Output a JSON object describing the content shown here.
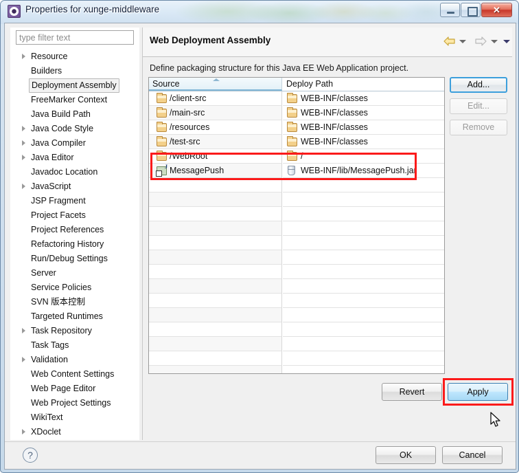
{
  "window": {
    "title": "Properties for xunge-middleware",
    "icon": "eclipse-properties-icon",
    "controls": {
      "minimize": "minimize-button",
      "maximize": "maximize-button",
      "close_glyph": "✕"
    }
  },
  "sidebar": {
    "filter": {
      "placeholder": "type filter text",
      "value": ""
    },
    "items": [
      {
        "label": "Resource",
        "expandable": true,
        "selected": false
      },
      {
        "label": "Builders",
        "expandable": false,
        "selected": false
      },
      {
        "label": "Deployment Assembly",
        "expandable": false,
        "selected": true
      },
      {
        "label": "FreeMarker Context",
        "expandable": false,
        "selected": false
      },
      {
        "label": "Java Build Path",
        "expandable": false,
        "selected": false
      },
      {
        "label": "Java Code Style",
        "expandable": true,
        "selected": false
      },
      {
        "label": "Java Compiler",
        "expandable": true,
        "selected": false
      },
      {
        "label": "Java Editor",
        "expandable": true,
        "selected": false
      },
      {
        "label": "Javadoc Location",
        "expandable": false,
        "selected": false
      },
      {
        "label": "JavaScript",
        "expandable": true,
        "selected": false
      },
      {
        "label": "JSP Fragment",
        "expandable": false,
        "selected": false
      },
      {
        "label": "Project Facets",
        "expandable": false,
        "selected": false
      },
      {
        "label": "Project References",
        "expandable": false,
        "selected": false
      },
      {
        "label": "Refactoring History",
        "expandable": false,
        "selected": false
      },
      {
        "label": "Run/Debug Settings",
        "expandable": false,
        "selected": false
      },
      {
        "label": "Server",
        "expandable": false,
        "selected": false
      },
      {
        "label": "Service Policies",
        "expandable": false,
        "selected": false
      },
      {
        "label": "SVN 版本控制",
        "expandable": false,
        "selected": false
      },
      {
        "label": "Targeted Runtimes",
        "expandable": false,
        "selected": false
      },
      {
        "label": "Task Repository",
        "expandable": true,
        "selected": false
      },
      {
        "label": "Task Tags",
        "expandable": false,
        "selected": false
      },
      {
        "label": "Validation",
        "expandable": true,
        "selected": false
      },
      {
        "label": "Web Content Settings",
        "expandable": false,
        "selected": false
      },
      {
        "label": "Web Page Editor",
        "expandable": false,
        "selected": false
      },
      {
        "label": "Web Project Settings",
        "expandable": false,
        "selected": false
      },
      {
        "label": "WikiText",
        "expandable": false,
        "selected": false
      },
      {
        "label": "XDoclet",
        "expandable": true,
        "selected": false
      }
    ]
  },
  "page": {
    "title": "Web Deployment Assembly",
    "description": "Define packaging structure for this Java EE Web Application project.",
    "nav": {
      "back_icon": "back-arrow-icon",
      "back_dropdown_icon": "chevron-down-icon",
      "forward_icon": "forward-arrow-icon",
      "forward_dropdown_icon": "chevron-down-icon",
      "menu_icon": "chevron-down-icon"
    }
  },
  "table": {
    "columns": [
      {
        "key": "source",
        "label": "Source",
        "sorted": "asc"
      },
      {
        "key": "deploy",
        "label": "Deploy Path",
        "sorted": ""
      }
    ],
    "rows": [
      {
        "source": "/client-src",
        "source_icon": "folder-icon",
        "deploy": "WEB-INF/classes",
        "deploy_icon": "folder-icon"
      },
      {
        "source": "/main-src",
        "source_icon": "folder-icon",
        "deploy": "WEB-INF/classes",
        "deploy_icon": "folder-icon"
      },
      {
        "source": "/resources",
        "source_icon": "folder-icon",
        "deploy": "WEB-INF/classes",
        "deploy_icon": "folder-icon"
      },
      {
        "source": "/test-src",
        "source_icon": "folder-icon",
        "deploy": "WEB-INF/classes",
        "deploy_icon": "folder-icon"
      },
      {
        "source": "/WebRoot",
        "source_icon": "folder-icon",
        "deploy": "/",
        "deploy_icon": "folder-icon"
      },
      {
        "source": "MessagePush",
        "source_icon": "java-project-icon",
        "deploy": "WEB-INF/lib/MessagePush.jar",
        "deploy_icon": "jar-icon",
        "highlighted": true
      }
    ],
    "empty_row_count": 15
  },
  "buttons": {
    "add": {
      "label": "Add...",
      "enabled": true,
      "focused": true
    },
    "edit": {
      "label": "Edit...",
      "enabled": false
    },
    "remove": {
      "label": "Remove",
      "enabled": false
    },
    "revert": {
      "label": "Revert",
      "enabled": true
    },
    "apply": {
      "label": "Apply",
      "enabled": true,
      "hover": true,
      "annotated": true
    },
    "ok": {
      "label": "OK"
    },
    "cancel": {
      "label": "Cancel"
    },
    "help": {
      "label": "?"
    }
  },
  "annotations": {
    "highlight_color": "#fb1a1a",
    "regions": [
      "messagepush-table-row",
      "apply-button"
    ]
  },
  "colors": {
    "accent_blue": "#3c9fdc",
    "annotation_red": "#fb1a1a",
    "title_text": "#12203a",
    "folder_icon": "#f3d08a",
    "dialog_bg": "#f0f0f0"
  }
}
